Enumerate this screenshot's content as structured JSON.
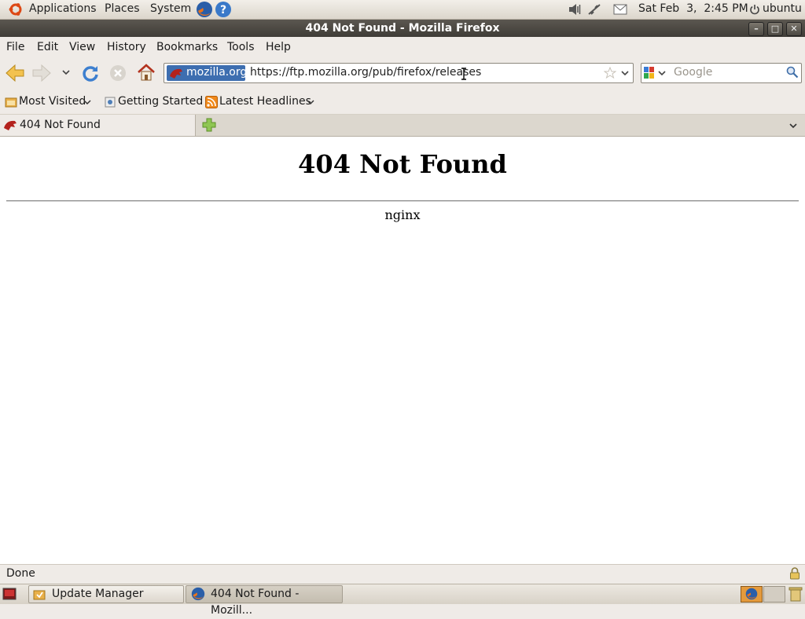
{
  "panel": {
    "applications": "Applications",
    "places": "Places",
    "system": "System",
    "clock": "Sat Feb  3,  2:45 PM",
    "user": "ubuntu"
  },
  "window": {
    "title": "404 Not Found - Mozilla Firefox"
  },
  "menu": [
    "File",
    "Edit",
    "View",
    "History",
    "Bookmarks",
    "Tools",
    "Help"
  ],
  "navigation": {
    "site_identity": "mozilla.org",
    "url": "https://ftp.mozilla.org/pub/firefox/releases",
    "search_placeholder": "Google"
  },
  "bookmarks": {
    "most_visited": "Most Visited",
    "getting_started": "Getting Started",
    "latest_headlines": "Latest Headlines"
  },
  "tabs": [
    {
      "label": "404 Not Found"
    }
  ],
  "page": {
    "heading": "404 Not Found",
    "server": "nginx"
  },
  "status": {
    "text": "Done"
  },
  "taskbar": [
    {
      "label": "Update Manager"
    },
    {
      "label": "404 Not Found - Mozill..."
    }
  ],
  "colors": {
    "selection": "#3d6eb0",
    "titlebar": "#4a4742"
  }
}
